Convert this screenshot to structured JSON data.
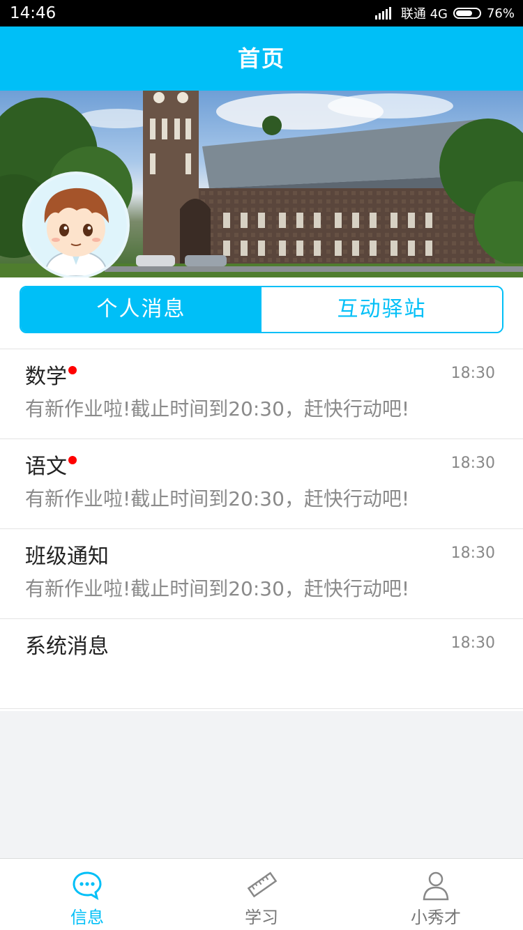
{
  "status_bar": {
    "time": "14:46",
    "carrier": "联通 4G",
    "battery": "76%",
    "battery_level": 0.76
  },
  "header": {
    "title": "首页"
  },
  "segments": {
    "active": "个人消息",
    "inactive": "互动驿站"
  },
  "messages": [
    {
      "title": "数学",
      "time": "18:30",
      "subtitle": "有新作业啦!截止时间到20:30，赶快行动吧!",
      "unread": true
    },
    {
      "title": "语文",
      "time": "18:30",
      "subtitle": "有新作业啦!截止时间到20:30，赶快行动吧!",
      "unread": true
    },
    {
      "title": "班级通知",
      "time": "18:30",
      "subtitle": "有新作业啦!截止时间到20:30，赶快行动吧!",
      "unread": false
    },
    {
      "title": "系统消息",
      "time": "18:30",
      "subtitle": "",
      "unread": false
    }
  ],
  "tabbar": {
    "items": [
      {
        "label": "信息",
        "icon": "chat-bubble-icon",
        "active": true
      },
      {
        "label": "学习",
        "icon": "ruler-icon",
        "active": false
      },
      {
        "label": "小秀才",
        "icon": "user-icon",
        "active": false
      }
    ]
  },
  "colors": {
    "accent": "#00bff7",
    "unread_dot": "#ff0000",
    "status_bar": "#000000"
  }
}
